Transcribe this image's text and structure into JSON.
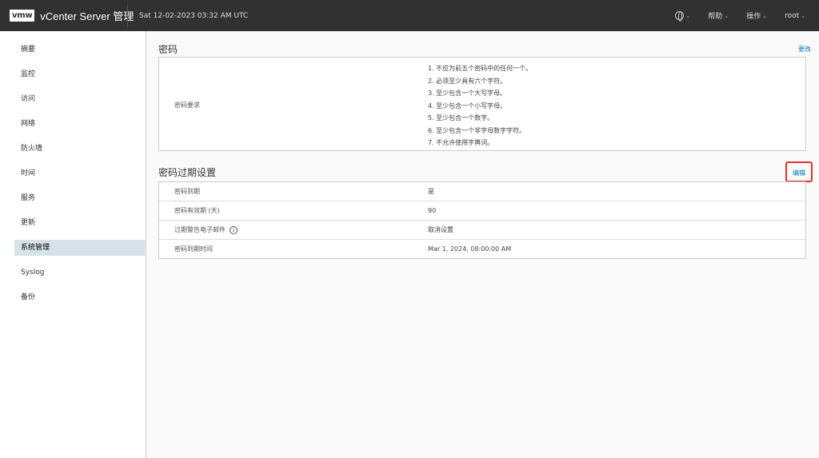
{
  "header": {
    "logo_text": "vmw",
    "app_title": "vCenter Server 管理",
    "datetime": "Sat 12-02-2023 03:32 AM UTC",
    "globe_chevron": "⌄",
    "help_label": "帮助",
    "actions_label": "操作",
    "user_label": "root"
  },
  "sidebar": {
    "items": [
      {
        "label": "摘要"
      },
      {
        "label": "监控"
      },
      {
        "label": "访问"
      },
      {
        "label": "网络"
      },
      {
        "label": "防火墙"
      },
      {
        "label": "时间"
      },
      {
        "label": "服务"
      },
      {
        "label": "更新"
      },
      {
        "label": "系统管理"
      },
      {
        "label": "Syslog"
      },
      {
        "label": "备份"
      }
    ],
    "active_item": "系统管理"
  },
  "password": {
    "title": "密码",
    "change_link": "更改",
    "requirements_label": "密码要求",
    "requirements": [
      "1. 不应为前五个密码中的任何一个。",
      "2. 必须至少具有六个字符。",
      "3. 至少包含一个大写字母。",
      "4. 至少包含一个小写字母。",
      "5. 至少包含一个数字。",
      "6. 至少包含一个非字母数字字符。",
      "7. 不允许使用字典词。"
    ]
  },
  "expiration": {
    "title": "密码过期设置",
    "edit_link": "编辑",
    "rows": [
      {
        "key": "密码到期",
        "value": "是"
      },
      {
        "key": "密码有效期 (天)",
        "value": "90"
      },
      {
        "key": "过期警告电子邮件",
        "value": "取消设置",
        "info_icon": "i"
      },
      {
        "key": "密码到期时间",
        "value": "Mar 1, 2024, 08:00:00 AM"
      }
    ]
  },
  "colors": {
    "topbar": "#313131",
    "accent_link": "#0079b8",
    "active_nav": "#d8e3e9",
    "highlight_box": "#e0361f"
  }
}
